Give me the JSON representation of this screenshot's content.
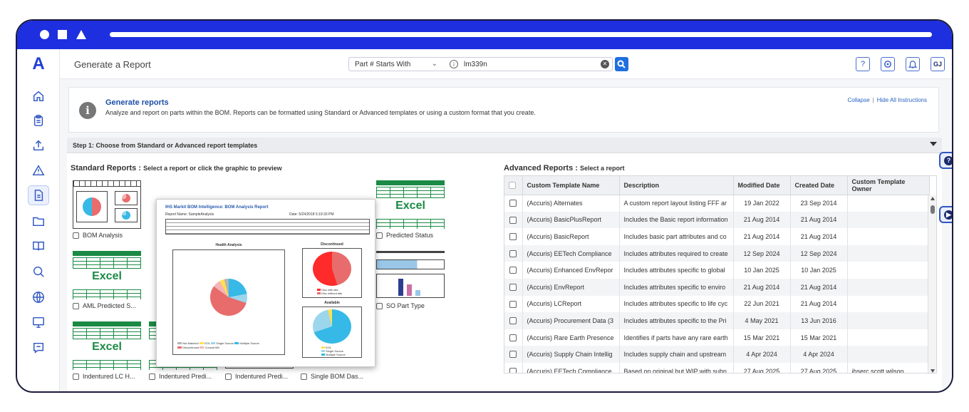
{
  "header": {
    "title": "Generate a Report",
    "search_type": "Part # Starts With",
    "search_value": "lm339n",
    "help_label": "?",
    "user_initials": "GJ"
  },
  "sidebar": {
    "logo": "A",
    "items": [
      "home",
      "clipboard",
      "upload",
      "alert",
      "report",
      "folder",
      "book",
      "search",
      "globe",
      "monitor",
      "chat"
    ]
  },
  "instructions": {
    "title": "Generate reports",
    "description": "Analyze and report on parts within the BOM. Reports can be formatted using Standard or Advanced templates or using a custom format that you create.",
    "collapse": "Collapse",
    "hide_all": "Hide All Instructions"
  },
  "step1": {
    "title": "Step 1: Choose from Standard or Advanced report templates"
  },
  "standard": {
    "title": "Standard Reports :",
    "subtitle": "Select a report or click the graphic to preview",
    "excel_text": "Excel",
    "tiles": [
      {
        "label": "BOM Analysis",
        "kind": "pie"
      },
      {
        "label": "Predicted Status",
        "kind": "excel"
      },
      {
        "label": "AML Predicted S...",
        "kind": "excel"
      },
      {
        "label": "SO Part Type",
        "kind": "bars"
      },
      {
        "label": "Indentured LC H...",
        "kind": "excel"
      },
      {
        "label": "Indentured Predi...",
        "kind": "excel"
      },
      {
        "label": "Indentured Predi...",
        "kind": "bars"
      },
      {
        "label": "Single BOM Das...",
        "kind": "hbars"
      }
    ]
  },
  "preview": {
    "title": "IHS Markit BOM Intelligence: BOM Analysis Report",
    "report_name": "Report Name: SampleAnalysis",
    "date": "Date: 5/24/2018 5:19:33 PM",
    "health": "Health Analysis",
    "discontinued": "Discontinued",
    "available": "Available",
    "legend1": "Disc with alts",
    "legend2": "Disc without alts",
    "legend_a": "EOL",
    "legend_b": "Single Source",
    "legend_c": "Multiple Source",
    "health_legend": [
      "Not Matched",
      "Discontinued",
      "EOL",
      "Consult Mfr",
      "Single Source",
      "Multiple Source"
    ]
  },
  "advanced": {
    "title": "Advanced Reports :",
    "subtitle": "Select a report",
    "columns": [
      "Custom Template Name",
      "Description",
      "Modified Date",
      "Created Date",
      "Custom Template Owner"
    ],
    "rows": [
      {
        "name": "(Accuris) Alternates",
        "desc": "A custom report layout listing FFF ar",
        "modified": "19 Jan 2022",
        "created": "23 Sep 2014",
        "owner": ""
      },
      {
        "name": "(Accuris) BasicPlusReport",
        "desc": "Includes the Basic report information",
        "modified": "21 Aug 2014",
        "created": "21 Aug 2014",
        "owner": ""
      },
      {
        "name": "(Accuris) BasicReport",
        "desc": "Includes basic part attributes and co",
        "modified": "21 Aug 2014",
        "created": "21 Aug 2014",
        "owner": ""
      },
      {
        "name": "(Accuris) EETech Compliance",
        "desc": "Includes attributes required to create",
        "modified": "12 Sep 2024",
        "created": "12 Sep 2024",
        "owner": ""
      },
      {
        "name": "(Accuris) Enhanced EnvRepor",
        "desc": "Includes attributes specific to global",
        "modified": "10 Jan 2025",
        "created": "10 Jan 2025",
        "owner": ""
      },
      {
        "name": "(Accuris) EnvReport",
        "desc": "Includes attributes specific to enviro",
        "modified": "21 Aug 2014",
        "created": "21 Aug 2014",
        "owner": ""
      },
      {
        "name": "(Accuris) LCReport",
        "desc": "Includes attributes specific to life cyc",
        "modified": "22 Jun 2021",
        "created": "21 Aug 2014",
        "owner": ""
      },
      {
        "name": "(Accuris) Procurement Data (3",
        "desc": "Includes attributes specific to the Pri",
        "modified": "4 May 2021",
        "created": "13 Jun 2016",
        "owner": ""
      },
      {
        "name": "(Accuris) Rare Earth Presence",
        "desc": "Identifies if parts have any rare earth",
        "modified": "15 Mar 2021",
        "created": "15 Mar 2021",
        "owner": ""
      },
      {
        "name": "(Accuris) Supply Chain Intellig",
        "desc": "Includes supply chain and upstream",
        "modified": "4 Apr 2024",
        "created": "4 Apr 2024",
        "owner": ""
      },
      {
        "name": "(Accuris) EETech Compliance",
        "desc": "Based on original but WIP with subn",
        "modified": "27 Aug 2025",
        "created": "27 Aug 2025",
        "owner": "ihserc.scott.wilson"
      }
    ]
  },
  "colors": {
    "brand": "#1e2fe0",
    "accent": "#1f6fe0",
    "excel": "#1a8a45",
    "pie_blue": "#36b9e6",
    "pie_red": "#e86c6c"
  }
}
